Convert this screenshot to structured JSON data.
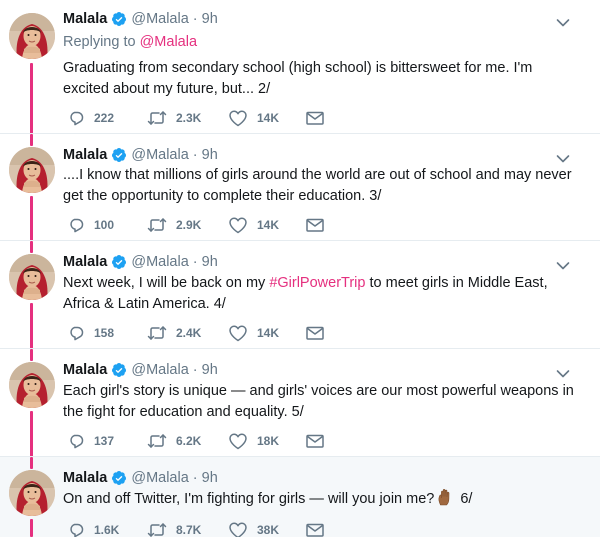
{
  "reply_prefix": "Replying to",
  "reply_target": "@Malala",
  "tweets": [
    {
      "name": "Malala",
      "handle": "@Malala",
      "dot": "·",
      "time": "9h",
      "text": "Graduating from secondary school (high school) is bittersweet for me. I'm excited about my future, but... 2/",
      "replies": "222",
      "retweets": "2.3K",
      "likes": "14K"
    },
    {
      "name": "Malala",
      "handle": "@Malala",
      "dot": "·",
      "time": "9h",
      "text": "....I know that millions of girls around the world are out of school and may never get the opportunity to complete their education. 3/",
      "replies": "100",
      "retweets": "2.9K",
      "likes": "14K"
    },
    {
      "name": "Malala",
      "handle": "@Malala",
      "dot": "·",
      "time": "9h",
      "text_before": "Next week, I will be back on my ",
      "hashtag": "#GirlPowerTrip",
      "text_after": " to meet girls in Middle East, Africa & Latin America. 4/",
      "replies": "158",
      "retweets": "2.4K",
      "likes": "14K"
    },
    {
      "name": "Malala",
      "handle": "@Malala",
      "dot": "·",
      "time": "9h",
      "text": "Each girl's story is unique — and girls' voices are our most powerful weapons in the fight for education and equality. 5/",
      "replies": "137",
      "retweets": "6.2K",
      "likes": "18K"
    },
    {
      "name": "Malala",
      "handle": "@Malala",
      "dot": "·",
      "time": "9h",
      "text_before": "On and off Twitter, I'm fighting for girls — will you join me?",
      "text_after": " 6/",
      "emoji": "raised-hand-emoji",
      "replies": "1.6K",
      "retweets": "8.7K",
      "likes": "38K"
    }
  ],
  "icons": {
    "verified": "verified-badge-icon",
    "caret": "chevron-down-icon",
    "reply": "reply-icon",
    "retweet": "retweet-icon",
    "like": "heart-icon",
    "dm": "envelope-icon"
  },
  "colors": {
    "link": "#e5307f",
    "thread_line": "#e5307f",
    "verified": "#1da1f2",
    "muted": "#657786",
    "text": "#14171a",
    "highlight_bg": "#f5f8fa"
  }
}
